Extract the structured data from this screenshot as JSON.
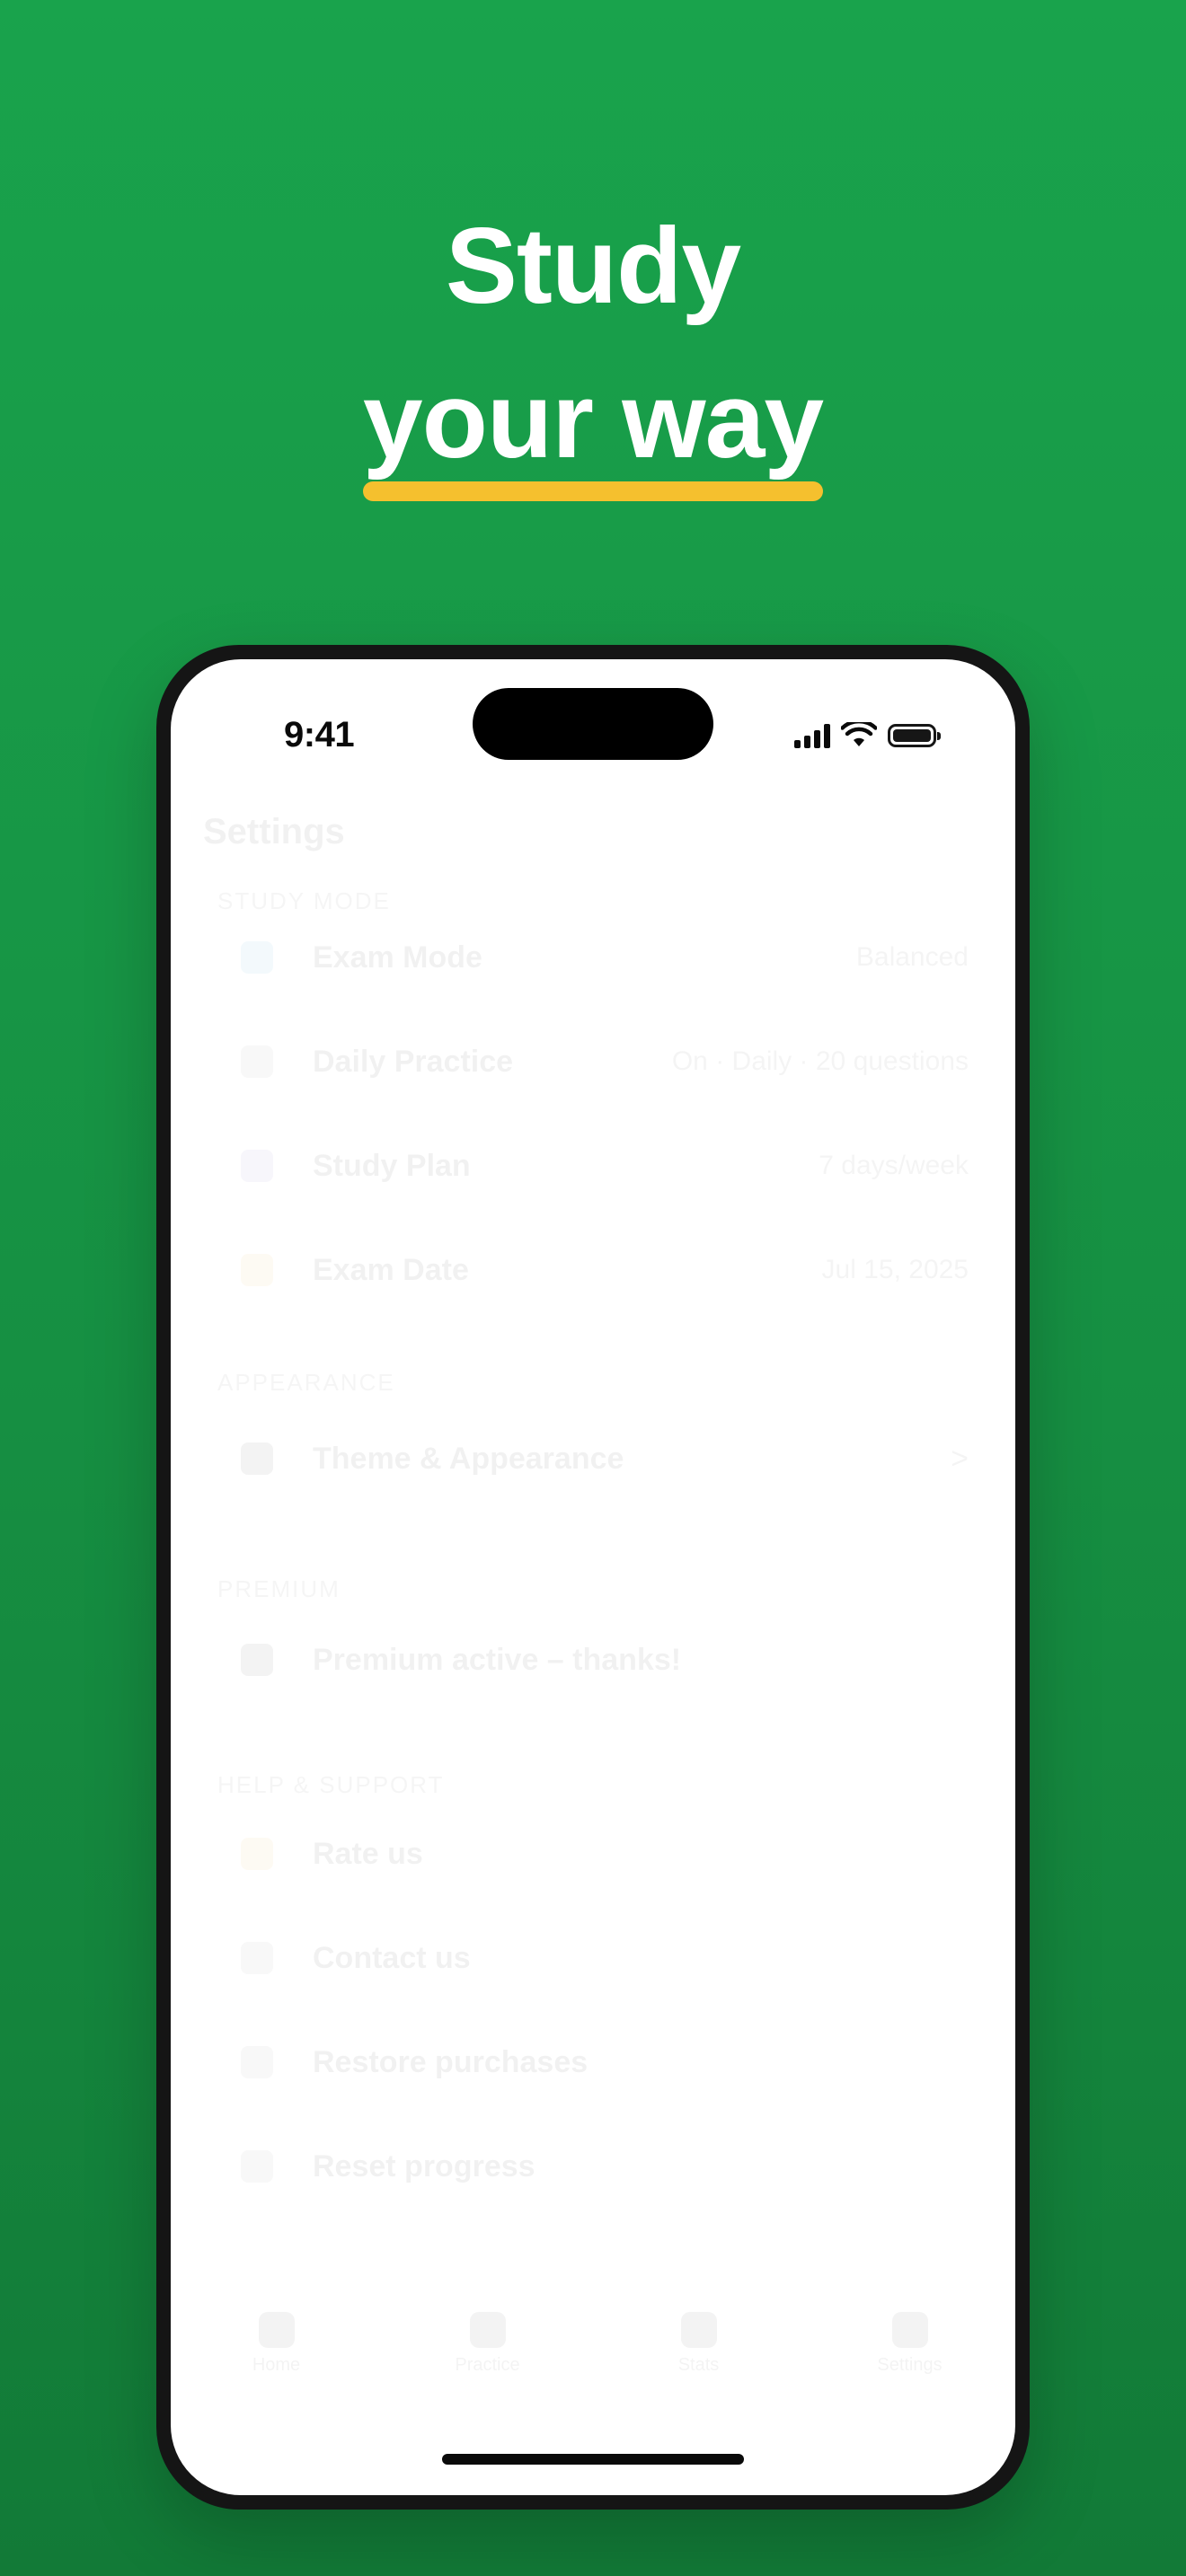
{
  "headline": {
    "line1": "Study",
    "line2": "your way",
    "underline_color": "#F5C02E"
  },
  "status_bar": {
    "time": "9:41",
    "icons": [
      "signal-icon",
      "wifi-icon",
      "battery-icon"
    ]
  },
  "settings": {
    "title": "Settings",
    "sections": [
      {
        "header": "Study Mode",
        "rows": [
          {
            "icon": "exam-mode-icon",
            "icon_color": "#2F9BD6",
            "label": "Exam Mode",
            "value": "Balanced"
          },
          {
            "icon": "daily-practice-icon",
            "icon_color": "#888888",
            "label": "Daily Practice",
            "value": "On · Daily · 20 questions"
          },
          {
            "icon": "study-plan-icon",
            "icon_color": "#7A5CC8",
            "label": "Study Plan",
            "value": "7 days/week"
          },
          {
            "icon": "calendar-icon",
            "icon_color": "#E8A52A",
            "label": "Exam Date",
            "value": "Jul 15, 2025"
          }
        ]
      },
      {
        "header": "Appearance",
        "rows": [
          {
            "icon": "theme-icon",
            "icon_color": "#333333",
            "label": "Theme & Appearance",
            "value": ">"
          }
        ]
      },
      {
        "header": "Premium",
        "rows": [
          {
            "icon": "premium-icon",
            "icon_color": "#333333",
            "label": "Premium active – thanks!",
            "value": ""
          }
        ]
      },
      {
        "header": "Help & Support",
        "rows": [
          {
            "icon": "star-icon",
            "icon_color": "#E8A52A",
            "label": "Rate us",
            "value": ""
          },
          {
            "icon": "mail-icon",
            "icon_color": "#888888",
            "label": "Contact us",
            "value": ""
          },
          {
            "icon": "restore-icon",
            "icon_color": "#888888",
            "label": "Restore purchases",
            "value": ""
          },
          {
            "icon": "reset-icon",
            "icon_color": "#888888",
            "label": "Reset progress",
            "value": ""
          }
        ]
      }
    ]
  },
  "tabbar": {
    "tabs": [
      {
        "label": "Home",
        "icon": "home-icon"
      },
      {
        "label": "Practice",
        "icon": "practice-icon"
      },
      {
        "label": "Stats",
        "icon": "stats-icon"
      },
      {
        "label": "Settings",
        "icon": "settings-icon"
      }
    ]
  },
  "colors": {
    "background_top": "#19A34C",
    "background_bottom": "#127A37",
    "accent_underline": "#F5C02E",
    "phone_frame": "#151515"
  }
}
